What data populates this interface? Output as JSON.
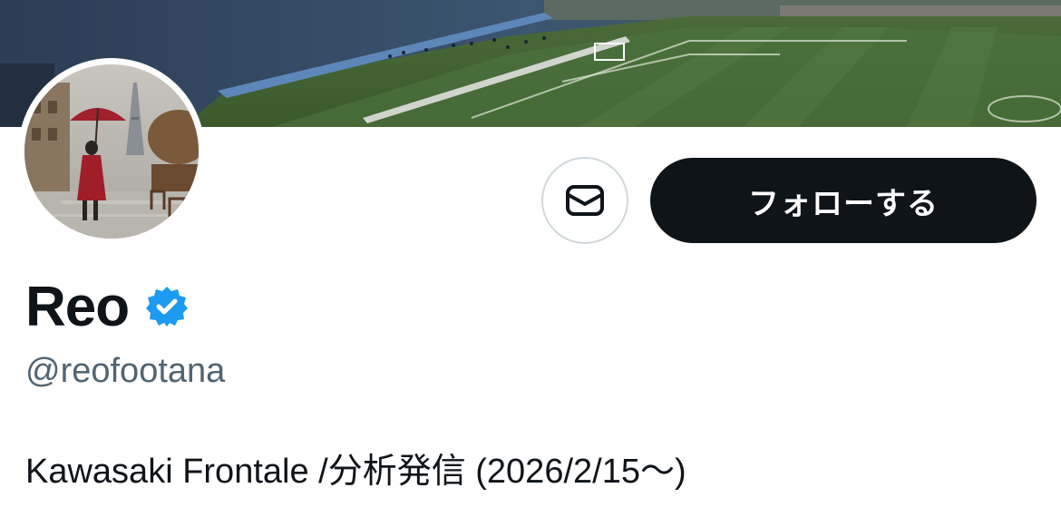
{
  "profile": {
    "display_name": "Reo",
    "verified": true,
    "handle": "@reofootana",
    "bio": "Kawasaki Frontale /分析発信 (2026/2/15～)"
  },
  "actions": {
    "message_icon": "envelope-icon",
    "follow_label": "フォローする"
  },
  "images": {
    "banner": "stadium-pitch-photo",
    "avatar": "painting-woman-red-umbrella-paris"
  },
  "colors": {
    "follow_bg": "#0f1419",
    "follow_text": "#ffffff",
    "verified_badge": "#1d9bf0",
    "handle_text": "#536471",
    "primary_text": "#0f1419",
    "button_border": "#cfd9de"
  }
}
